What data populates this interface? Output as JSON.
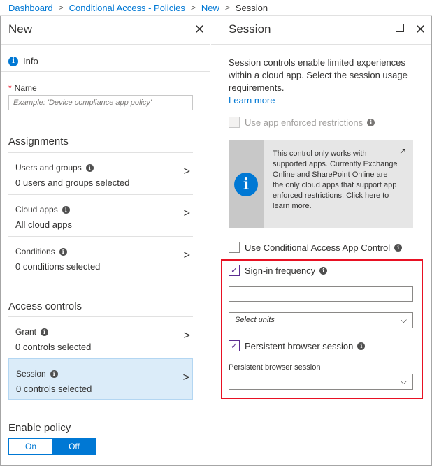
{
  "breadcrumb": {
    "items": [
      "Dashboard",
      "Conditional Access - Policies",
      "New",
      "Session"
    ],
    "separator": ">"
  },
  "left_blade": {
    "title": "New",
    "close_icon": "close-icon",
    "info_label": "Info",
    "name_label": "Name",
    "name_placeholder": "Example: 'Device compliance app policy'",
    "assignments_title": "Assignments",
    "assignments": [
      {
        "label": "Users and groups",
        "value": "0 users and groups selected"
      },
      {
        "label": "Cloud apps",
        "value": "All cloud apps"
      },
      {
        "label": "Conditions",
        "value": "0 conditions selected"
      }
    ],
    "access_controls_title": "Access controls",
    "access_controls": [
      {
        "label": "Grant",
        "value": "0 controls selected"
      },
      {
        "label": "Session",
        "value": "0 controls selected",
        "selected": true
      }
    ],
    "enable_policy_title": "Enable policy",
    "toggle": {
      "on": "On",
      "off": "Off",
      "selected": "Off"
    }
  },
  "right_blade": {
    "title": "Session",
    "description": "Session controls enable limited experiences within a cloud app. Select the session usage requirements.",
    "learn_more": "Learn more",
    "app_enforced": {
      "label": "Use app enforced restrictions",
      "checked": false,
      "disabled": true
    },
    "info_box": {
      "text": "This control only works with supported apps. Currently Exchange Online and SharePoint Online are the only cloud apps that support app enforced restrictions. Click here to learn more.",
      "icon": "external-link-icon"
    },
    "app_control": {
      "label": "Use Conditional Access App Control",
      "checked": false
    },
    "sign_in_frequency": {
      "label": "Sign-in frequency",
      "checked": true,
      "value": ""
    },
    "units_select": {
      "placeholder": "Select units"
    },
    "persistent": {
      "label": "Persistent browser session",
      "checked": true
    },
    "persistent_select": {
      "label": "Persistent browser session",
      "value": ""
    }
  },
  "colors": {
    "accent": "#0078d4",
    "highlight_border": "#e81123",
    "check_color": "#5c2d91",
    "selected_bg": "#dbecf9"
  }
}
